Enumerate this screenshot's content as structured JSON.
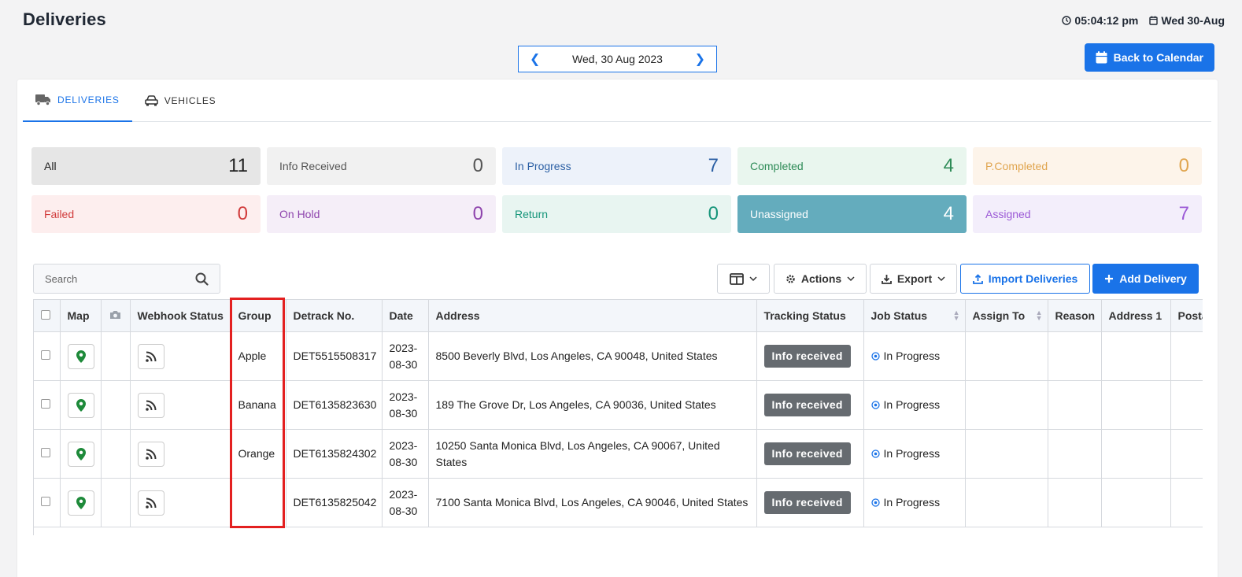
{
  "header": {
    "title": "Deliveries",
    "time": "05:04:12 pm",
    "date": "Wed 30-Aug"
  },
  "date_nav": {
    "label": "Wed, 30 Aug 2023"
  },
  "back_button": "Back to Calendar",
  "tabs": [
    {
      "label": "DELIVERIES",
      "active": true
    },
    {
      "label": "VEHICLES",
      "active": false
    }
  ],
  "stats": [
    {
      "label": "All",
      "count": "11",
      "bg": "#e6e6e6",
      "color": "#222222",
      "count_color": "#222222"
    },
    {
      "label": "Info Received",
      "count": "0",
      "bg": "#f1f1f1",
      "color": "#555555",
      "count_color": "#555555"
    },
    {
      "label": "In Progress",
      "count": "7",
      "bg": "#edf2fa",
      "color": "#2b5fa4",
      "count_color": "#2b5fa4"
    },
    {
      "label": "Completed",
      "count": "4",
      "bg": "#e9f6ee",
      "color": "#2e8b57",
      "count_color": "#2e8b57"
    },
    {
      "label": "P.Completed",
      "count": "0",
      "bg": "#fdf4ea",
      "color": "#e0a54f",
      "count_color": "#e0a54f"
    },
    {
      "label": "Failed",
      "count": "0",
      "bg": "#fdeeee",
      "color": "#d13b3b",
      "count_color": "#d13b3b"
    },
    {
      "label": "On Hold",
      "count": "0",
      "bg": "#f5eef8",
      "color": "#8e44ad",
      "count_color": "#8e44ad"
    },
    {
      "label": "Return",
      "count": "0",
      "bg": "#e8f5f1",
      "color": "#16957a",
      "count_color": "#16957a"
    },
    {
      "label": "Unassigned",
      "count": "4",
      "bg": "#64acbd",
      "color": "#ffffff",
      "count_color": "#ffffff"
    },
    {
      "label": "Assigned",
      "count": "7",
      "bg": "#f3eefb",
      "color": "#9b59d6",
      "count_color": "#9b59d6"
    }
  ],
  "toolbar": {
    "search_placeholder": "Search",
    "actions": "Actions",
    "export": "Export",
    "import": "Import Deliveries",
    "add": "Add Delivery"
  },
  "table": {
    "columns": [
      "Map",
      "Webhook Status",
      "Group",
      "Detrack No.",
      "Date",
      "Address",
      "Tracking Status",
      "Job Status",
      "Assign To",
      "Reason",
      "Address 1",
      "Posta"
    ],
    "rows": [
      {
        "group": "Apple",
        "detrack_no": "DET5515508317",
        "date_1": "2023-",
        "date_2": "08-30",
        "address": "8500 Beverly Blvd, Los Angeles, CA 90048, United States",
        "tracking": "Info received",
        "job_status": "In Progress"
      },
      {
        "group": "Banana",
        "detrack_no": "DET6135823630",
        "date_1": "2023-",
        "date_2": "08-30",
        "address": "189 The Grove Dr, Los Angeles, CA 90036, United States",
        "tracking": "Info received",
        "job_status": "In Progress"
      },
      {
        "group": "Orange",
        "detrack_no": "DET6135824302",
        "date_1": "2023-",
        "date_2": "08-30",
        "address": "10250 Santa Monica Blvd, Los Angeles, CA 90067, United States",
        "tracking": "Info received",
        "job_status": "In Progress"
      },
      {
        "group": "",
        "detrack_no": "DET6135825042",
        "date_1": "2023-",
        "date_2": "08-30",
        "address": "7100 Santa Monica Blvd, Los Angeles, CA 90046, United States",
        "tracking": "Info received",
        "job_status": "In Progress"
      }
    ]
  },
  "colors": {
    "accent": "#1a73e8",
    "map_pin": "#1e8a3a",
    "highlight": "#e32020"
  }
}
